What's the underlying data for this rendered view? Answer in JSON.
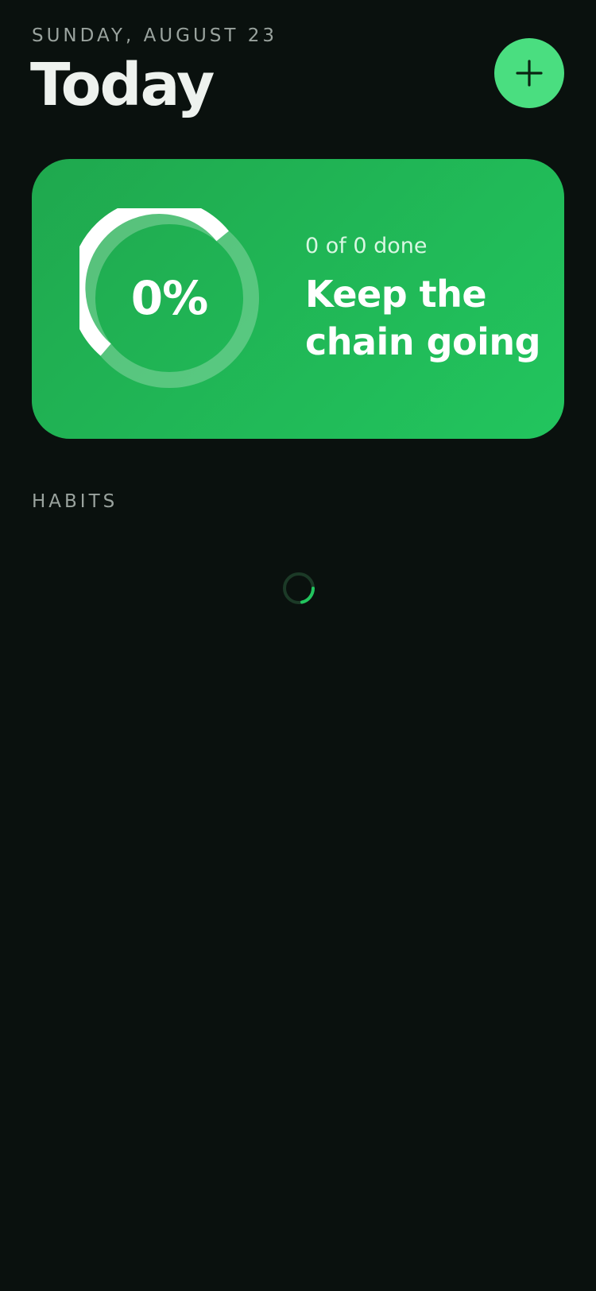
{
  "header": {
    "date": "SUNDAY, AUGUST 23",
    "title": "Today"
  },
  "summary": {
    "percent_label": "0%",
    "done_text": "0 of 0 done",
    "message": "Keep the chain going"
  },
  "habits": {
    "heading": "HABITS",
    "loading": true
  },
  "icons": {
    "add": "plus-icon",
    "spinner": "loading-spinner-icon"
  },
  "colors": {
    "background": "#0a110e",
    "accent": "#4ade80",
    "card": "#22c55e",
    "text_primary": "#eef2ee",
    "text_secondary": "#9aa39e"
  }
}
